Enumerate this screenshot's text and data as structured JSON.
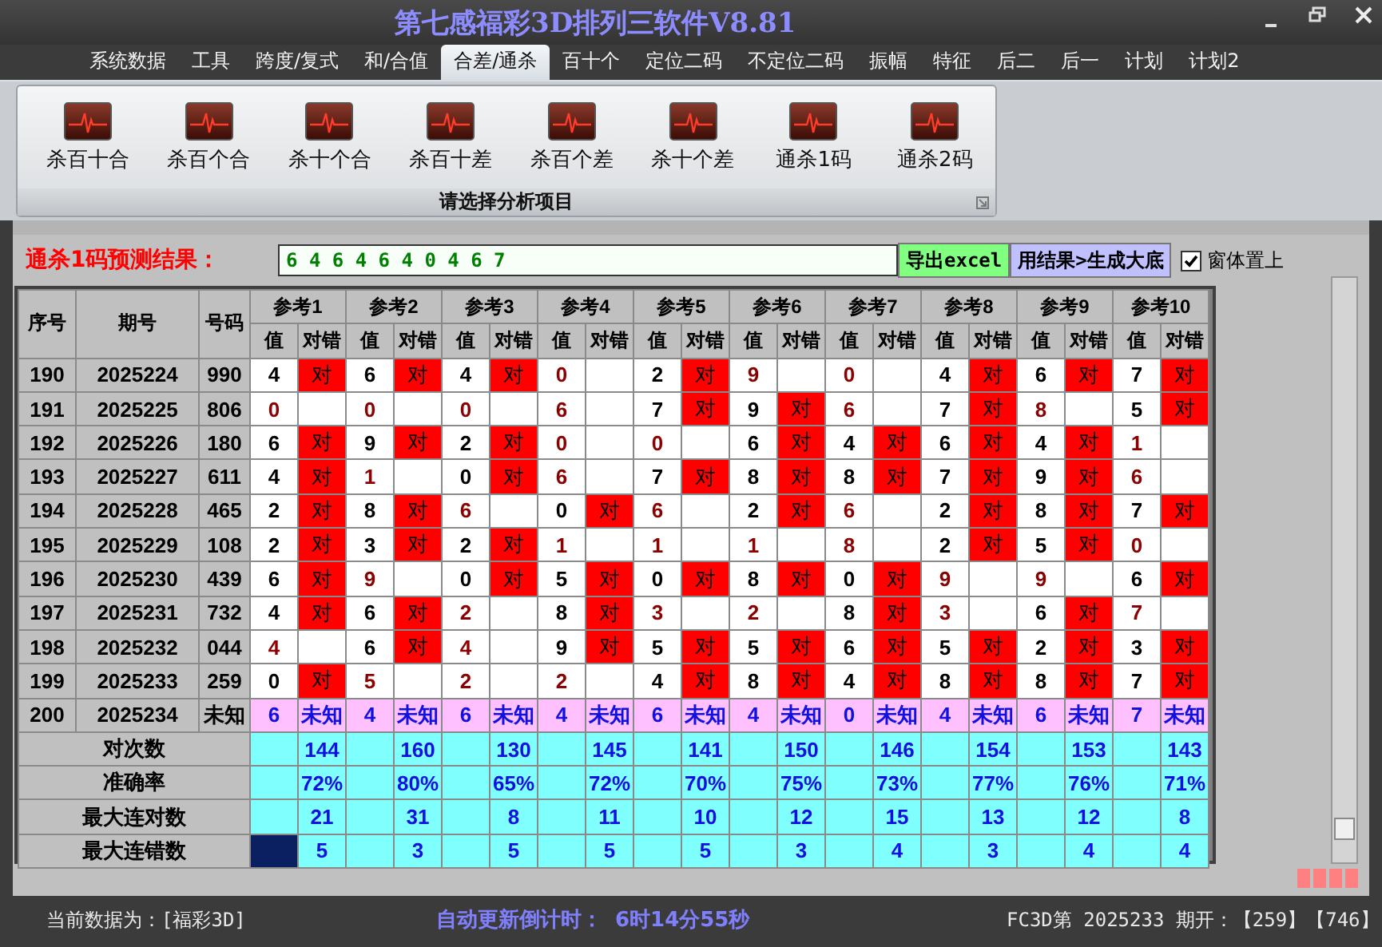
{
  "window": {
    "title": "第七感福彩3D排列三软件V8.81"
  },
  "menu": [
    {
      "label": "系统数据",
      "selected": false
    },
    {
      "label": "工具",
      "selected": false
    },
    {
      "label": "跨度/复式",
      "selected": false
    },
    {
      "label": "和/合值",
      "selected": false
    },
    {
      "label": "合差/通杀",
      "selected": true
    },
    {
      "label": "百十个",
      "selected": false
    },
    {
      "label": "定位二码",
      "selected": false
    },
    {
      "label": "不定位二码",
      "selected": false
    },
    {
      "label": "振幅",
      "selected": false
    },
    {
      "label": "特征",
      "selected": false
    },
    {
      "label": "后二",
      "selected": false
    },
    {
      "label": "后一",
      "selected": false
    },
    {
      "label": "计划",
      "selected": false
    },
    {
      "label": "计划2",
      "selected": false
    }
  ],
  "ribbon": {
    "items": [
      "杀百十合",
      "杀百个合",
      "杀十个合",
      "杀百十差",
      "杀百个差",
      "杀十个差",
      "通杀1码",
      "通杀2码"
    ],
    "caption": "请选择分析项目"
  },
  "prediction": {
    "label": "通杀1码预测结果：",
    "value": "6 4 6 4 6 4 0 4 6 7",
    "buttons": [
      {
        "label": "导出excel",
        "kind": "export"
      },
      {
        "label": "用结果>生成大底",
        "kind": "generate"
      }
    ],
    "stay_on_top": {
      "label": "窗体置上",
      "checked": true
    }
  },
  "table": {
    "columns": [
      "序号",
      "期号",
      "号码"
    ],
    "groups": [
      {
        "label": "参考1",
        "sub_columns": [
          "值",
          "对错"
        ]
      },
      {
        "label": "参考2",
        "sub_columns": [
          "值",
          "对错"
        ]
      },
      {
        "label": "参考3",
        "sub_columns": [
          "值",
          "对错"
        ]
      },
      {
        "label": "参考4",
        "sub_columns": [
          "值",
          "对错"
        ]
      },
      {
        "label": "参考5",
        "sub_columns": [
          "值",
          "对错"
        ]
      },
      {
        "label": "参考6",
        "sub_columns": [
          "值",
          "对错"
        ]
      },
      {
        "label": "参考7",
        "sub_columns": [
          "值",
          "对错"
        ]
      },
      {
        "label": "参考8",
        "sub_columns": [
          "值",
          "对错"
        ]
      },
      {
        "label": "参考9",
        "sub_columns": [
          "值",
          "对错"
        ]
      },
      {
        "label": "参考10",
        "sub_columns": [
          "值",
          "对错"
        ]
      }
    ],
    "rows": [
      {
        "kind": "history",
        "seq": "190",
        "period": "2025224",
        "number": "990",
        "refs": [
          {
            "value": "4",
            "hit": true,
            "result": "对"
          },
          {
            "value": "6",
            "hit": true,
            "result": "对"
          },
          {
            "value": "4",
            "hit": true,
            "result": "对"
          },
          {
            "value": "0",
            "hit": false
          },
          {
            "value": "2",
            "hit": true,
            "result": "对"
          },
          {
            "value": "9",
            "hit": false
          },
          {
            "value": "0",
            "hit": false
          },
          {
            "value": "4",
            "hit": true,
            "result": "对"
          },
          {
            "value": "6",
            "hit": true,
            "result": "对"
          },
          {
            "value": "7",
            "hit": true,
            "result": "对"
          }
        ]
      },
      {
        "kind": "history",
        "seq": "191",
        "period": "2025225",
        "number": "806",
        "refs": [
          {
            "value": "0",
            "hit": false
          },
          {
            "value": "0",
            "hit": false
          },
          {
            "value": "0",
            "hit": false
          },
          {
            "value": "6",
            "hit": false
          },
          {
            "value": "7",
            "hit": true,
            "result": "对"
          },
          {
            "value": "9",
            "hit": true,
            "result": "对"
          },
          {
            "value": "6",
            "hit": false
          },
          {
            "value": "7",
            "hit": true,
            "result": "对"
          },
          {
            "value": "8",
            "hit": false
          },
          {
            "value": "5",
            "hit": true,
            "result": "对"
          }
        ]
      },
      {
        "kind": "history",
        "seq": "192",
        "period": "2025226",
        "number": "180",
        "refs": [
          {
            "value": "6",
            "hit": true,
            "result": "对"
          },
          {
            "value": "9",
            "hit": true,
            "result": "对"
          },
          {
            "value": "2",
            "hit": true,
            "result": "对"
          },
          {
            "value": "0",
            "hit": false
          },
          {
            "value": "0",
            "hit": false
          },
          {
            "value": "6",
            "hit": true,
            "result": "对"
          },
          {
            "value": "4",
            "hit": true,
            "result": "对"
          },
          {
            "value": "6",
            "hit": true,
            "result": "对"
          },
          {
            "value": "4",
            "hit": true,
            "result": "对"
          },
          {
            "value": "1",
            "hit": false
          }
        ]
      },
      {
        "kind": "history",
        "seq": "193",
        "period": "2025227",
        "number": "611",
        "refs": [
          {
            "value": "4",
            "hit": true,
            "result": "对"
          },
          {
            "value": "1",
            "hit": false
          },
          {
            "value": "0",
            "hit": true,
            "result": "对"
          },
          {
            "value": "6",
            "hit": false
          },
          {
            "value": "7",
            "hit": true,
            "result": "对"
          },
          {
            "value": "8",
            "hit": true,
            "result": "对"
          },
          {
            "value": "8",
            "hit": true,
            "result": "对"
          },
          {
            "value": "7",
            "hit": true,
            "result": "对"
          },
          {
            "value": "9",
            "hit": true,
            "result": "对"
          },
          {
            "value": "6",
            "hit": false
          }
        ]
      },
      {
        "kind": "history",
        "seq": "194",
        "period": "2025228",
        "number": "465",
        "refs": [
          {
            "value": "2",
            "hit": true,
            "result": "对"
          },
          {
            "value": "8",
            "hit": true,
            "result": "对"
          },
          {
            "value": "6",
            "hit": false
          },
          {
            "value": "0",
            "hit": true,
            "result": "对"
          },
          {
            "value": "6",
            "hit": false
          },
          {
            "value": "2",
            "hit": true,
            "result": "对"
          },
          {
            "value": "6",
            "hit": false
          },
          {
            "value": "2",
            "hit": true,
            "result": "对"
          },
          {
            "value": "8",
            "hit": true,
            "result": "对"
          },
          {
            "value": "7",
            "hit": true,
            "result": "对"
          }
        ]
      },
      {
        "kind": "history",
        "seq": "195",
        "period": "2025229",
        "number": "108",
        "refs": [
          {
            "value": "2",
            "hit": true,
            "result": "对"
          },
          {
            "value": "3",
            "hit": true,
            "result": "对"
          },
          {
            "value": "2",
            "hit": true,
            "result": "对"
          },
          {
            "value": "1",
            "hit": false
          },
          {
            "value": "1",
            "hit": false
          },
          {
            "value": "1",
            "hit": false
          },
          {
            "value": "8",
            "hit": false
          },
          {
            "value": "2",
            "hit": true,
            "result": "对"
          },
          {
            "value": "5",
            "hit": true,
            "result": "对"
          },
          {
            "value": "0",
            "hit": false
          }
        ]
      },
      {
        "kind": "history",
        "seq": "196",
        "period": "2025230",
        "number": "439",
        "refs": [
          {
            "value": "6",
            "hit": true,
            "result": "对"
          },
          {
            "value": "9",
            "hit": false
          },
          {
            "value": "0",
            "hit": true,
            "result": "对"
          },
          {
            "value": "5",
            "hit": true,
            "result": "对"
          },
          {
            "value": "0",
            "hit": true,
            "result": "对"
          },
          {
            "value": "8",
            "hit": true,
            "result": "对"
          },
          {
            "value": "0",
            "hit": true,
            "result": "对"
          },
          {
            "value": "9",
            "hit": false
          },
          {
            "value": "9",
            "hit": false
          },
          {
            "value": "6",
            "hit": true,
            "result": "对"
          }
        ]
      },
      {
        "kind": "history",
        "seq": "197",
        "period": "2025231",
        "number": "732",
        "refs": [
          {
            "value": "4",
            "hit": true,
            "result": "对"
          },
          {
            "value": "6",
            "hit": true,
            "result": "对"
          },
          {
            "value": "2",
            "hit": false
          },
          {
            "value": "8",
            "hit": true,
            "result": "对"
          },
          {
            "value": "3",
            "hit": false
          },
          {
            "value": "2",
            "hit": false
          },
          {
            "value": "8",
            "hit": true,
            "result": "对"
          },
          {
            "value": "3",
            "hit": false
          },
          {
            "value": "6",
            "hit": true,
            "result": "对"
          },
          {
            "value": "7",
            "hit": false
          }
        ]
      },
      {
        "kind": "history",
        "seq": "198",
        "period": "2025232",
        "number": "044",
        "refs": [
          {
            "value": "4",
            "hit": false
          },
          {
            "value": "6",
            "hit": true,
            "result": "对"
          },
          {
            "value": "4",
            "hit": false
          },
          {
            "value": "9",
            "hit": true,
            "result": "对"
          },
          {
            "value": "5",
            "hit": true,
            "result": "对"
          },
          {
            "value": "5",
            "hit": true,
            "result": "对"
          },
          {
            "value": "6",
            "hit": true,
            "result": "对"
          },
          {
            "value": "5",
            "hit": true,
            "result": "对"
          },
          {
            "value": "2",
            "hit": true,
            "result": "对"
          },
          {
            "value": "3",
            "hit": true,
            "result": "对"
          }
        ]
      },
      {
        "kind": "history",
        "seq": "199",
        "period": "2025233",
        "number": "259",
        "refs": [
          {
            "value": "0",
            "hit": true,
            "result": "对"
          },
          {
            "value": "5",
            "hit": false
          },
          {
            "value": "2",
            "hit": false
          },
          {
            "value": "2",
            "hit": false
          },
          {
            "value": "4",
            "hit": true,
            "result": "对"
          },
          {
            "value": "8",
            "hit": true,
            "result": "对"
          },
          {
            "value": "4",
            "hit": true,
            "result": "对"
          },
          {
            "value": "8",
            "hit": true,
            "result": "对"
          },
          {
            "value": "8",
            "hit": true,
            "result": "对"
          },
          {
            "value": "7",
            "hit": true,
            "result": "对"
          }
        ]
      },
      {
        "kind": "forecast",
        "seq": "200",
        "period": "2025234",
        "number": "未知",
        "refs": [
          {
            "value": "6",
            "result": "未知"
          },
          {
            "value": "4",
            "result": "未知"
          },
          {
            "value": "6",
            "result": "未知"
          },
          {
            "value": "4",
            "result": "未知"
          },
          {
            "value": "6",
            "result": "未知"
          },
          {
            "value": "4",
            "result": "未知"
          },
          {
            "value": "0",
            "result": "未知"
          },
          {
            "value": "4",
            "result": "未知"
          },
          {
            "value": "6",
            "result": "未知"
          },
          {
            "value": "7",
            "result": "未知"
          }
        ]
      }
    ],
    "stats": [
      {
        "label": "对次数",
        "values": [
          "144",
          "160",
          "130",
          "145",
          "141",
          "150",
          "146",
          "154",
          "153",
          "143"
        ],
        "first_cell_selected": false
      },
      {
        "label": "准确率",
        "values": [
          "72%",
          "80%",
          "65%",
          "72%",
          "70%",
          "75%",
          "73%",
          "77%",
          "76%",
          "71%"
        ],
        "first_cell_selected": false
      },
      {
        "label": "最大连对数",
        "values": [
          "21",
          "31",
          "8",
          "11",
          "10",
          "12",
          "15",
          "13",
          "12",
          "8"
        ],
        "first_cell_selected": false
      },
      {
        "label": "最大连错数",
        "values": [
          "5",
          "3",
          "5",
          "5",
          "5",
          "3",
          "4",
          "3",
          "4",
          "4"
        ],
        "first_cell_selected": true
      }
    ]
  },
  "status_bar": {
    "data_source": "当前数据为：[福彩3D]",
    "countdown_label": "自动更新倒计时：",
    "countdown": "6时14分55秒",
    "draw_info": "FC3D第 2025233 期开：【259】【746】"
  }
}
